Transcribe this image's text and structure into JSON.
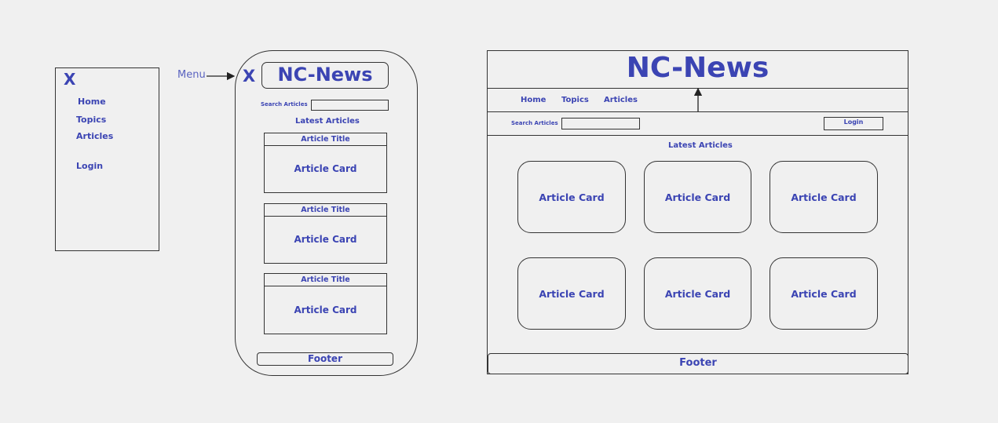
{
  "side_menu": {
    "close_label": "X",
    "items": [
      "Home",
      "Topics",
      "Articles",
      "Login"
    ]
  },
  "annotation": {
    "menu_label": "Menu"
  },
  "mobile": {
    "close_label": "X",
    "logo": "NC-News",
    "search_label": "Search Articles",
    "latest_label": "Latest Articles",
    "cards": [
      {
        "title": "Article Title",
        "body": "Article Card"
      },
      {
        "title": "Article Title",
        "body": "Article Card"
      },
      {
        "title": "Article Title",
        "body": "Article Card"
      }
    ],
    "footer": "Footer"
  },
  "desktop": {
    "logo": "NC-News",
    "nav": [
      "Home",
      "Topics",
      "Articles"
    ],
    "search_label": "Search Articles",
    "login_label": "Login",
    "latest_label": "Latest Articles",
    "cards": [
      "Article Card",
      "Article Card",
      "Article Card",
      "Article Card",
      "Article Card",
      "Article Card"
    ],
    "footer": "Footer"
  },
  "colors": {
    "text_accent": "#3b44b3",
    "outline": "#333333",
    "background": "#f0f0f0"
  }
}
